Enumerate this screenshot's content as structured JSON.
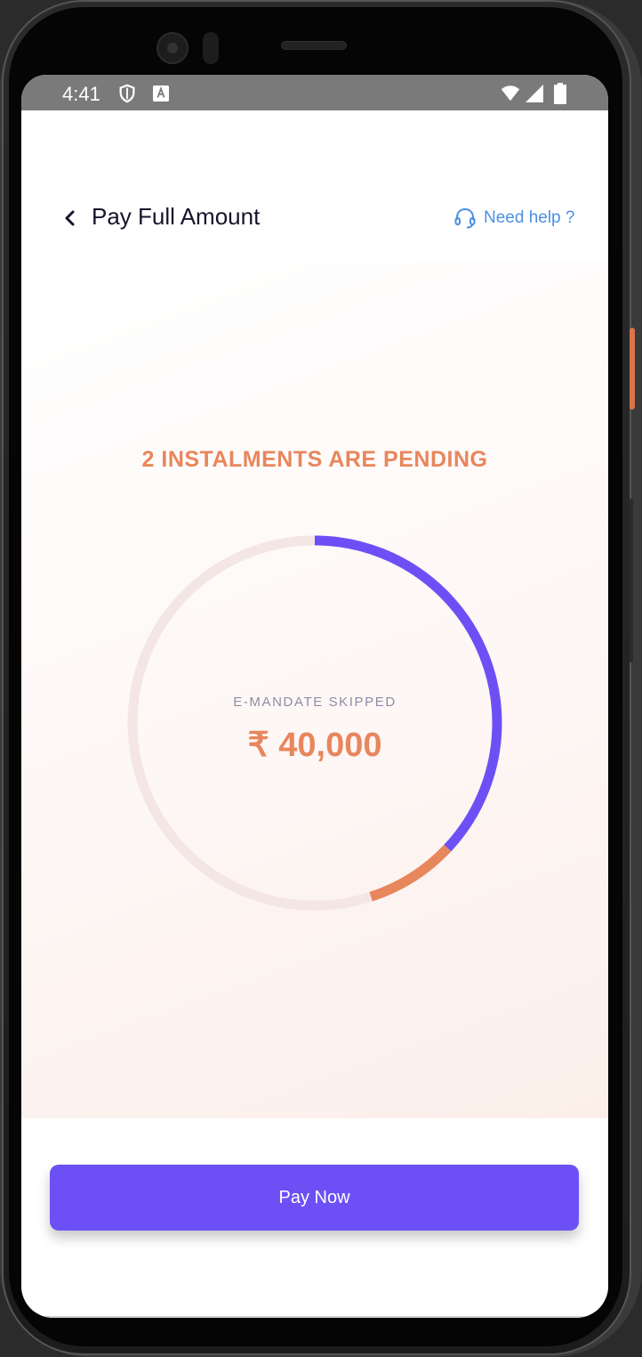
{
  "status_bar": {
    "time": "4:41",
    "icons": [
      "shield-icon",
      "a-notification-icon",
      "wifi-icon",
      "signal-icon",
      "battery-icon"
    ]
  },
  "header": {
    "title": "Pay Full Amount",
    "help_label": "Need help ?",
    "back_icon": "chevron-left-icon",
    "help_icon": "headset-icon"
  },
  "main": {
    "pending_title": "2 INSTALMENTS ARE PENDING",
    "ring_label": "E-MANDATE SKIPPED",
    "amount": "₹ 40,000",
    "progress": {
      "paid_fraction": 0.37,
      "skipped_fraction": 0.08
    }
  },
  "footer": {
    "pay_button_label": "Pay Now"
  },
  "colors": {
    "accent_purple": "#6d50f5",
    "accent_orange": "#e8865c",
    "help_blue": "#4d8fe3",
    "ring_track": "#f4e6e4"
  }
}
